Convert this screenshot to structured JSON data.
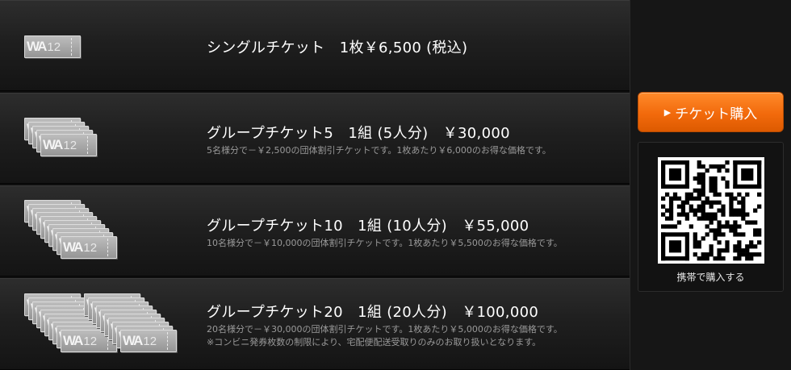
{
  "tickets": [
    {
      "title": "シングルチケット　1枚￥6,500 (税込)",
      "desc": ""
    },
    {
      "title": "グループチケット5　1組 (5人分)　￥30,000",
      "desc": "5名様分で－￥2,500の団体割引チケットです。1枚あたり￥6,000のお得な価格です。"
    },
    {
      "title": "グループチケット10　1組 (10人分)　￥55,000",
      "desc": "10名様分で－￥10,000の団体割引チケットです。1枚あたり￥5,500のお得な価格です。"
    },
    {
      "title": "グループチケット20　1組 (20人分)　￥100,000",
      "desc": "20名様分で－￥30,000の団体割引チケットです。1枚あたり￥5,000のお得な価格です。",
      "note": "※コンビニ発券枚数の制限により、宅配便配送受取りのみのお取り扱いとなります。"
    }
  ],
  "ticket_logo": {
    "letters": "WA",
    "number": "12"
  },
  "sidebar": {
    "buy_label": "チケット購入",
    "qr_label": "携帯で購入する"
  },
  "colors": {
    "accent": "#f26a0c",
    "ticket": "#a8a8a8",
    "background": "#121212"
  },
  "icons": {
    "buy_arrow": "triangle-right-icon",
    "qr": "qr-code-icon"
  }
}
